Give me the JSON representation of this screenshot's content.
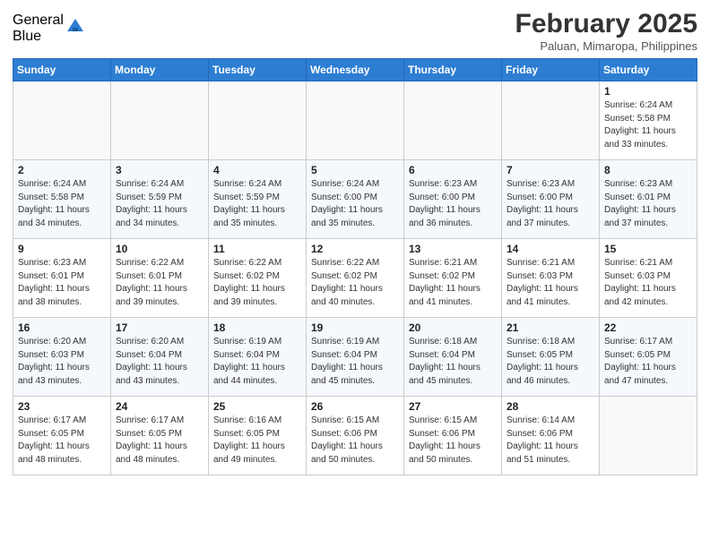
{
  "logo": {
    "general": "General",
    "blue": "Blue"
  },
  "calendar": {
    "title": "February 2025",
    "location": "Paluan, Mimaropa, Philippines",
    "days": [
      "Sunday",
      "Monday",
      "Tuesday",
      "Wednesday",
      "Thursday",
      "Friday",
      "Saturday"
    ],
    "weeks": [
      [
        {
          "num": "",
          "info": ""
        },
        {
          "num": "",
          "info": ""
        },
        {
          "num": "",
          "info": ""
        },
        {
          "num": "",
          "info": ""
        },
        {
          "num": "",
          "info": ""
        },
        {
          "num": "",
          "info": ""
        },
        {
          "num": "1",
          "info": "Sunrise: 6:24 AM\nSunset: 5:58 PM\nDaylight: 11 hours\nand 33 minutes."
        }
      ],
      [
        {
          "num": "2",
          "info": "Sunrise: 6:24 AM\nSunset: 5:58 PM\nDaylight: 11 hours\nand 34 minutes."
        },
        {
          "num": "3",
          "info": "Sunrise: 6:24 AM\nSunset: 5:59 PM\nDaylight: 11 hours\nand 34 minutes."
        },
        {
          "num": "4",
          "info": "Sunrise: 6:24 AM\nSunset: 5:59 PM\nDaylight: 11 hours\nand 35 minutes."
        },
        {
          "num": "5",
          "info": "Sunrise: 6:24 AM\nSunset: 6:00 PM\nDaylight: 11 hours\nand 35 minutes."
        },
        {
          "num": "6",
          "info": "Sunrise: 6:23 AM\nSunset: 6:00 PM\nDaylight: 11 hours\nand 36 minutes."
        },
        {
          "num": "7",
          "info": "Sunrise: 6:23 AM\nSunset: 6:00 PM\nDaylight: 11 hours\nand 37 minutes."
        },
        {
          "num": "8",
          "info": "Sunrise: 6:23 AM\nSunset: 6:01 PM\nDaylight: 11 hours\nand 37 minutes."
        }
      ],
      [
        {
          "num": "9",
          "info": "Sunrise: 6:23 AM\nSunset: 6:01 PM\nDaylight: 11 hours\nand 38 minutes."
        },
        {
          "num": "10",
          "info": "Sunrise: 6:22 AM\nSunset: 6:01 PM\nDaylight: 11 hours\nand 39 minutes."
        },
        {
          "num": "11",
          "info": "Sunrise: 6:22 AM\nSunset: 6:02 PM\nDaylight: 11 hours\nand 39 minutes."
        },
        {
          "num": "12",
          "info": "Sunrise: 6:22 AM\nSunset: 6:02 PM\nDaylight: 11 hours\nand 40 minutes."
        },
        {
          "num": "13",
          "info": "Sunrise: 6:21 AM\nSunset: 6:02 PM\nDaylight: 11 hours\nand 41 minutes."
        },
        {
          "num": "14",
          "info": "Sunrise: 6:21 AM\nSunset: 6:03 PM\nDaylight: 11 hours\nand 41 minutes."
        },
        {
          "num": "15",
          "info": "Sunrise: 6:21 AM\nSunset: 6:03 PM\nDaylight: 11 hours\nand 42 minutes."
        }
      ],
      [
        {
          "num": "16",
          "info": "Sunrise: 6:20 AM\nSunset: 6:03 PM\nDaylight: 11 hours\nand 43 minutes."
        },
        {
          "num": "17",
          "info": "Sunrise: 6:20 AM\nSunset: 6:04 PM\nDaylight: 11 hours\nand 43 minutes."
        },
        {
          "num": "18",
          "info": "Sunrise: 6:19 AM\nSunset: 6:04 PM\nDaylight: 11 hours\nand 44 minutes."
        },
        {
          "num": "19",
          "info": "Sunrise: 6:19 AM\nSunset: 6:04 PM\nDaylight: 11 hours\nand 45 minutes."
        },
        {
          "num": "20",
          "info": "Sunrise: 6:18 AM\nSunset: 6:04 PM\nDaylight: 11 hours\nand 45 minutes."
        },
        {
          "num": "21",
          "info": "Sunrise: 6:18 AM\nSunset: 6:05 PM\nDaylight: 11 hours\nand 46 minutes."
        },
        {
          "num": "22",
          "info": "Sunrise: 6:17 AM\nSunset: 6:05 PM\nDaylight: 11 hours\nand 47 minutes."
        }
      ],
      [
        {
          "num": "23",
          "info": "Sunrise: 6:17 AM\nSunset: 6:05 PM\nDaylight: 11 hours\nand 48 minutes."
        },
        {
          "num": "24",
          "info": "Sunrise: 6:17 AM\nSunset: 6:05 PM\nDaylight: 11 hours\nand 48 minutes."
        },
        {
          "num": "25",
          "info": "Sunrise: 6:16 AM\nSunset: 6:05 PM\nDaylight: 11 hours\nand 49 minutes."
        },
        {
          "num": "26",
          "info": "Sunrise: 6:15 AM\nSunset: 6:06 PM\nDaylight: 11 hours\nand 50 minutes."
        },
        {
          "num": "27",
          "info": "Sunrise: 6:15 AM\nSunset: 6:06 PM\nDaylight: 11 hours\nand 50 minutes."
        },
        {
          "num": "28",
          "info": "Sunrise: 6:14 AM\nSunset: 6:06 PM\nDaylight: 11 hours\nand 51 minutes."
        },
        {
          "num": "",
          "info": ""
        }
      ]
    ]
  }
}
